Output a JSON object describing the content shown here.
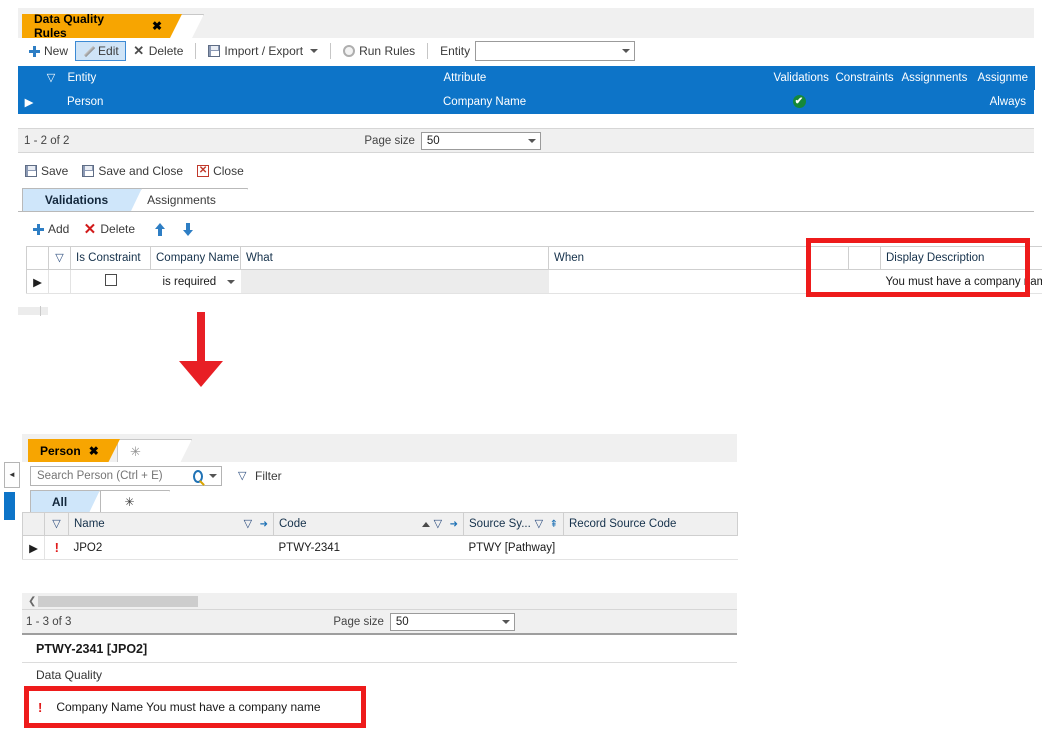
{
  "rules_window": {
    "tabs": [
      {
        "label": "Data Quality Rules",
        "close": "✖",
        "active": true
      },
      {
        "label": "✳",
        "active": false
      }
    ],
    "toolbar": {
      "new": "New",
      "edit": "Edit",
      "delete": "Delete",
      "import_export": "Import / Export",
      "run_rules": "Run Rules",
      "entity_label": "Entity",
      "entity_value": ""
    },
    "grid": {
      "columns": [
        "",
        "",
        "Entity",
        "Attribute",
        "Validations",
        "Constraints",
        "Assignments",
        "Assignme"
      ],
      "rows": [
        {
          "cursor": "▶",
          "flag": "",
          "entity": "Person",
          "attribute": "Company Name",
          "validations": "✔",
          "constraints": "",
          "assignments": "",
          "assignme": "Always"
        }
      ]
    },
    "pager": {
      "range": "1 - 2 of 2",
      "page_size_label": "Page size",
      "page_size_value": "50"
    },
    "save_toolbar": {
      "save": "Save",
      "save_and_close": "Save and Close",
      "close": "Close"
    },
    "detail_tabs": [
      {
        "label": "Validations",
        "active": true
      },
      {
        "label": "Assignments",
        "active": false
      }
    ],
    "detail_toolbar": {
      "add": "Add",
      "delete": "Delete",
      "move_up": "↑",
      "move_down": "↓"
    },
    "validation_grid": {
      "columns": [
        "",
        "",
        "Is Constraint",
        "Company Name",
        "What",
        "When",
        "",
        "Display Description"
      ],
      "rows": [
        {
          "cursor": "▶",
          "is_constraint_checked": false,
          "company_name": "is required",
          "what": "",
          "when": "",
          "display_description": "You must have a company name"
        }
      ]
    }
  },
  "annotation": {
    "arrow_direction": "down",
    "arrow_color": "#e81f25",
    "highlight_color": "#ee1b1b"
  },
  "person_window": {
    "tabs": [
      {
        "label": "Person",
        "close": "✖",
        "active": true
      },
      {
        "label": "✳",
        "active": false
      }
    ],
    "search": {
      "placeholder": "Search Person (Ctrl + E)",
      "value": "",
      "filter_label": "Filter"
    },
    "view_tabs": [
      {
        "label": "All",
        "active": true
      },
      {
        "label": "✳",
        "active": false
      }
    ],
    "grid": {
      "columns": [
        "",
        "",
        "Name",
        "Code",
        "Source Sy...",
        "Record Source Code"
      ],
      "rows": [
        {
          "cursor": "▶",
          "status": "!",
          "name": "JPO2",
          "code": "PTWY-2341",
          "source_system": "PTWY [Pathway]",
          "record_source_code": ""
        }
      ]
    },
    "pager": {
      "range": "1 - 3 of 3",
      "page_size_label": "Page size",
      "page_size_value": "50"
    },
    "detail": {
      "title": "PTWY-2341 [JPO2]",
      "section_label": "Data Quality",
      "error": {
        "icon": "!",
        "text": "Company Name You must have a company name"
      }
    }
  }
}
